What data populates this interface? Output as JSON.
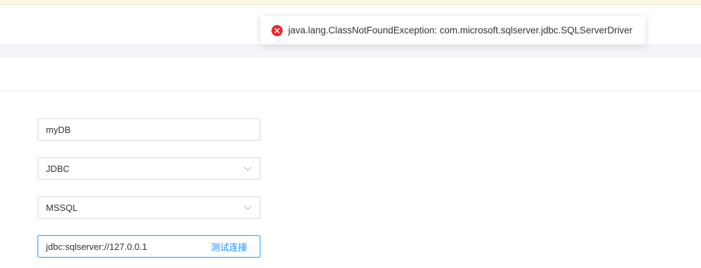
{
  "toast": {
    "type": "error",
    "icon": "error-circle-icon",
    "message": "java.lang.ClassNotFoundException: com.microsoft.sqlserver.jdbc.SQLServerDriver"
  },
  "form": {
    "name_value": "myDB",
    "connection_type": "JDBC",
    "database_type": "MSSQL",
    "jdbc_url": "jdbc:sqlserver://127.0.0.1",
    "test_connection_label": "测试连接"
  },
  "colors": {
    "error": "#f5222d",
    "link": "#1890ff",
    "focus_border": "#40a9ff",
    "notice_bg": "#fdf7e6"
  }
}
